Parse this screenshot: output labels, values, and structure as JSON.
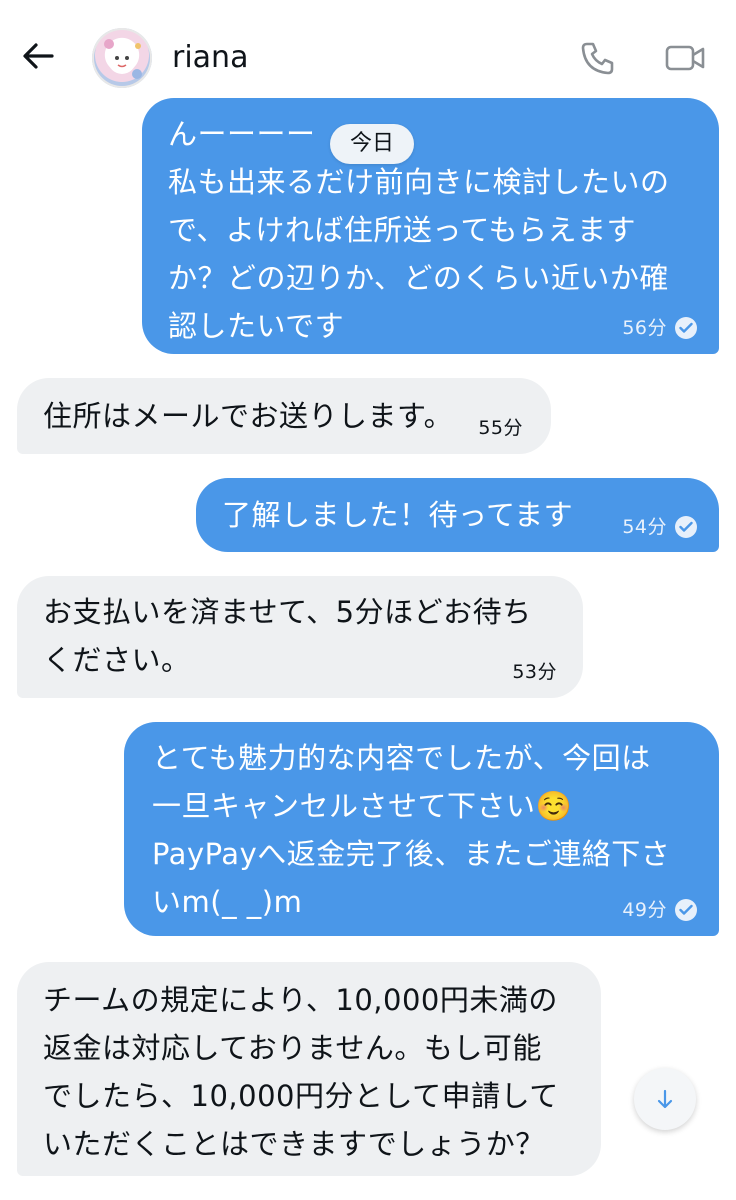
{
  "header": {
    "contact_name": "riana"
  },
  "date_divider": "今日",
  "messages": [
    {
      "direction": "out",
      "text": "んーーーー\n私も出来るだけ前向きに検討したいの\nで、よければ住所送ってもらえます\nか？どの辺りか、どのくらい近いか確\n認したいです",
      "time": "56分",
      "read": true
    },
    {
      "direction": "in",
      "text": "住所はメールでお送りします。",
      "time": "55分"
    },
    {
      "direction": "out",
      "text": "了解しました！待ってます",
      "time": "54分",
      "read": true
    },
    {
      "direction": "in",
      "text": "お支払いを済ませて、5分ほどお待ち\nください。",
      "time": "53分"
    },
    {
      "direction": "out",
      "text": "とても魅力的な内容でしたが、今回は\n一旦キャンセルさせて下さい☺️\nPayPayへ返金完了後、またご連絡下さ\nいm(_ _)m",
      "time": "49分",
      "read": true
    },
    {
      "direction": "in",
      "text": "チームの規定により、10,000円未満の\n返金は対応しておりません。もし可能\nでしたら、10,000円分として申請して\nいただくことはできますでしょうか？",
      "time": ""
    }
  ],
  "colors": {
    "outgoing_bubble": "#4a97e8",
    "incoming_bubble": "#eef0f2",
    "icon_gray": "#8a8f94"
  },
  "icons": {
    "back": "arrow-left-icon",
    "call": "phone-icon",
    "video": "video-camera-icon",
    "read": "check-circle-icon",
    "scroll": "arrow-down-icon"
  }
}
